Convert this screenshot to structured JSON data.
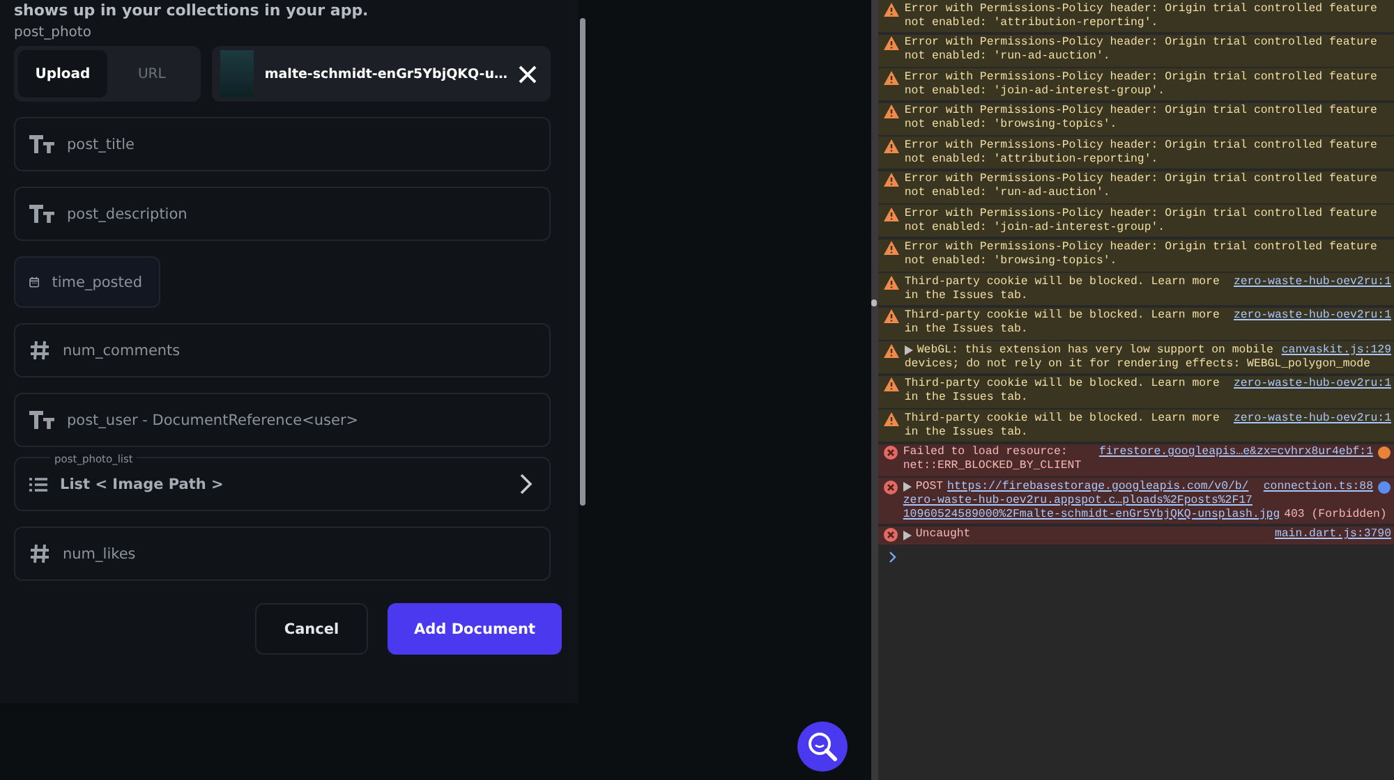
{
  "form": {
    "intro": "shows up in your collections in your app.",
    "photo_label": "post_photo",
    "tabs": [
      {
        "label": "Upload",
        "selected": true
      },
      {
        "label": "URL",
        "selected": false
      }
    ],
    "file_chip": {
      "name": "malte-schmidt-enGr5YbjQKQ-u…"
    },
    "fields": [
      {
        "kind": "text",
        "placeholder": "post_title"
      },
      {
        "kind": "text",
        "placeholder": "post_description"
      },
      {
        "kind": "date",
        "placeholder": "time_posted"
      },
      {
        "kind": "number",
        "placeholder": "num_comments"
      },
      {
        "kind": "text",
        "placeholder": "post_user - DocumentReference<user>"
      },
      {
        "kind": "list",
        "legend": "post_photo_list",
        "placeholder": "List < Image Path >"
      },
      {
        "kind": "number",
        "placeholder": "num_likes"
      }
    ],
    "buttons": [
      {
        "label": "Cancel",
        "kind": "secondary"
      },
      {
        "label": "Add Document",
        "kind": "primary"
      }
    ]
  },
  "console": {
    "entries": [
      {
        "kind": "warning",
        "expandable": false,
        "lines": [
          "Error with Permissions-Policy header: Origin trial controlled feature",
          "not enabled: 'attribution-reporting'."
        ]
      },
      {
        "kind": "warning",
        "expandable": false,
        "lines": [
          "Error with Permissions-Policy header: Origin trial controlled feature",
          "not enabled: 'run-ad-auction'."
        ]
      },
      {
        "kind": "warning",
        "expandable": false,
        "lines": [
          "Error with Permissions-Policy header: Origin trial controlled feature",
          "not enabled: 'join-ad-interest-group'."
        ]
      },
      {
        "kind": "warning",
        "expandable": false,
        "lines": [
          "Error with Permissions-Policy header: Origin trial controlled feature",
          "not enabled: 'browsing-topics'."
        ]
      },
      {
        "kind": "warning",
        "expandable": false,
        "lines": [
          "Error with Permissions-Policy header: Origin trial controlled feature",
          "not enabled: 'attribution-reporting'."
        ]
      },
      {
        "kind": "warning",
        "expandable": false,
        "lines": [
          "Error with Permissions-Policy header: Origin trial controlled feature",
          "not enabled: 'run-ad-auction'."
        ]
      },
      {
        "kind": "warning",
        "expandable": false,
        "lines": [
          "Error with Permissions-Policy header: Origin trial controlled feature",
          "not enabled: 'join-ad-interest-group'."
        ]
      },
      {
        "kind": "warning",
        "expandable": false,
        "lines": [
          "Error with Permissions-Policy header: Origin trial controlled feature",
          "not enabled: 'browsing-topics'."
        ]
      },
      {
        "kind": "warning",
        "expandable": false,
        "source": "zero-waste-hub-oev2ru:1",
        "lines": [
          "Third-party cookie will be blocked. Learn more",
          "in the Issues tab."
        ]
      },
      {
        "kind": "warning",
        "expandable": false,
        "source": "zero-waste-hub-oev2ru:1",
        "lines": [
          "Third-party cookie will be blocked. Learn more",
          "in the Issues tab."
        ]
      },
      {
        "kind": "warning",
        "expandable": true,
        "source": "canvaskit.js:129",
        "lines": [
          "WebGL: this extension has very low support on mobile",
          "devices; do not rely on it for rendering effects: WEBGL_polygon_mode"
        ]
      },
      {
        "kind": "warning",
        "expandable": false,
        "source": "zero-waste-hub-oev2ru:1",
        "lines": [
          "Third-party cookie will be blocked. Learn more",
          "in the Issues tab."
        ]
      },
      {
        "kind": "warning",
        "expandable": false,
        "source": "zero-waste-hub-oev2ru:1",
        "lines": [
          "Third-party cookie will be blocked. Learn more",
          "in the Issues tab."
        ]
      },
      {
        "kind": "error",
        "expandable": false,
        "source": "firestore.googleapis…e&zx=cvhrx8ur4ebf:1",
        "color": "#e8833a",
        "lines": [
          "Failed to load resource:",
          "net::ERR_BLOCKED_BY_CLIENT"
        ]
      },
      {
        "kind": "error",
        "expandable": true,
        "source": "connection.ts:88",
        "color": "#5b8def",
        "lines": [
          "POST"
        ],
        "url_lines": [
          "https://firebasestorage.googleapis.com/v0/b/",
          "zero-waste-hub-oev2ru.appspot.c…ploads%2Fposts%2F17",
          "10960524589000%2Fmalte-schmidt-enGr5YbjQKQ-unsplash.jpg"
        ],
        "suffix": "403 (Forbidden)"
      },
      {
        "kind": "error",
        "expandable": true,
        "source": "main.dart.js:3790",
        "lines": [
          "Uncaught"
        ]
      }
    ]
  }
}
